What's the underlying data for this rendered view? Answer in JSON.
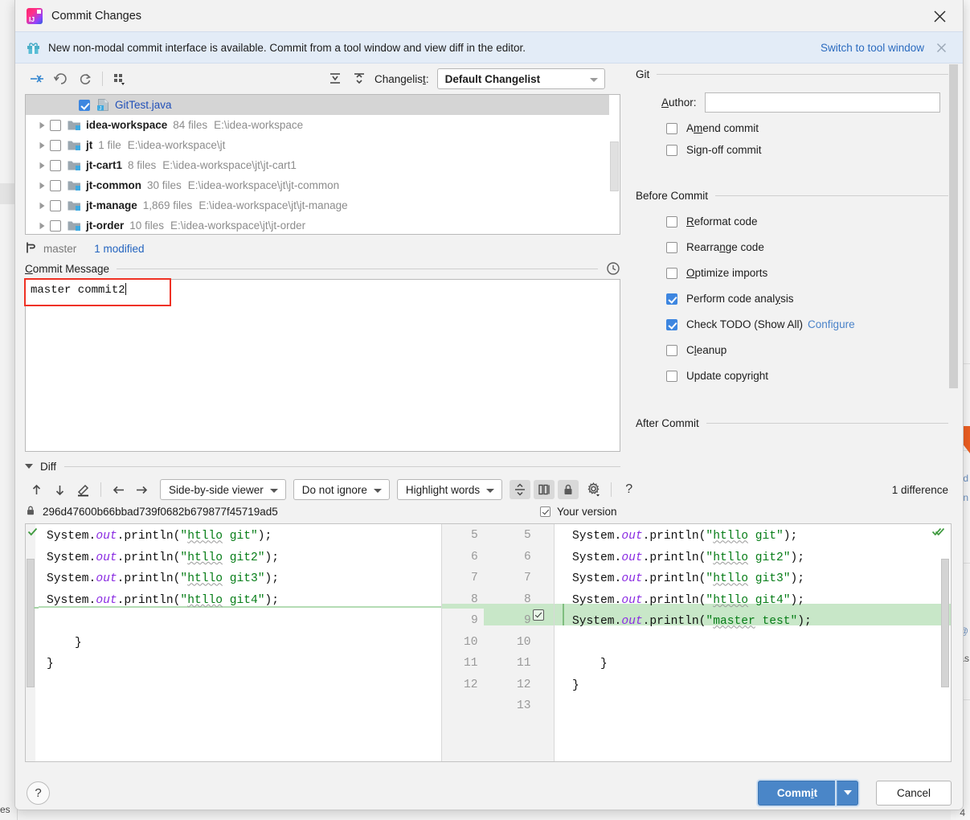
{
  "window": {
    "title": "Commit Changes",
    "logo_icon": "intellij-idea-logo",
    "close_icon": "close-icon"
  },
  "banner": {
    "icon": "gift-icon",
    "message": "New non-modal commit interface is available. Commit from a tool window and view diff in the editor.",
    "link": "Switch to tool window",
    "dismiss_icon": "close-icon"
  },
  "changelist_toolbar": {
    "icons": [
      "move-to-another-changelist-icon",
      "revert-icon",
      "refresh-icon",
      "group-by-icon"
    ],
    "expand_all_icon": "expand-all-icon",
    "collapse_all_icon": "collapse-all-icon",
    "label": "Changelist:",
    "label_mnemonic": "t",
    "selected": "Default Changelist",
    "dropdown_icon": "chevron-down-icon"
  },
  "file_tree": {
    "rows": [
      {
        "indent": 2,
        "twisty": false,
        "checked": true,
        "icon": "java-file-icon",
        "name": "GitTest.java",
        "meta": "",
        "path": "",
        "selected": true,
        "link": true
      },
      {
        "indent": 0,
        "twisty": true,
        "checked": false,
        "icon": "module-folder-icon",
        "name": "idea-workspace",
        "meta": "84 files",
        "path": "E:\\idea-workspace",
        "selected": false,
        "link": false
      },
      {
        "indent": 0,
        "twisty": true,
        "checked": false,
        "icon": "module-folder-icon",
        "name": "jt",
        "meta": "1 file",
        "path": "E:\\idea-workspace\\jt",
        "selected": false,
        "link": false
      },
      {
        "indent": 0,
        "twisty": true,
        "checked": false,
        "icon": "module-folder-icon",
        "name": "jt-cart1",
        "meta": "8 files",
        "path": "E:\\idea-workspace\\jt\\jt-cart1",
        "selected": false,
        "link": false
      },
      {
        "indent": 0,
        "twisty": true,
        "checked": false,
        "icon": "module-folder-icon",
        "name": "jt-common",
        "meta": "30 files",
        "path": "E:\\idea-workspace\\jt\\jt-common",
        "selected": false,
        "link": false
      },
      {
        "indent": 0,
        "twisty": true,
        "checked": false,
        "icon": "module-folder-icon",
        "name": "jt-manage",
        "meta": "1,869 files",
        "path": "E:\\idea-workspace\\jt\\jt-manage",
        "selected": false,
        "link": false
      },
      {
        "indent": 0,
        "twisty": true,
        "checked": false,
        "icon": "module-folder-icon",
        "name": "jt-order",
        "meta": "10 files",
        "path": "E:\\idea-workspace\\jt\\jt-order",
        "selected": false,
        "link": false
      }
    ]
  },
  "branch_status": {
    "icon": "git-branch-icon",
    "branch": "master",
    "modified": "1 modified"
  },
  "commit_message": {
    "label": "Commit Message",
    "label_mnemonic": "C",
    "history_icon": "clock-history-icon",
    "value": "master commit2"
  },
  "right_panel": {
    "git_group": "Git",
    "author_label": "Author:",
    "author_mnemonic": "A",
    "author_value": "",
    "git_options": [
      {
        "label": "Amend commit",
        "checked": false,
        "mnemonic": "m"
      },
      {
        "label": "Sign-off commit",
        "checked": false,
        "mnemonic": "g"
      }
    ],
    "before_commit_group": "Before Commit",
    "before_commit_options": [
      {
        "label": "Reformat code",
        "checked": false,
        "mnemonic": "R",
        "extra": ""
      },
      {
        "label": "Rearrange code",
        "checked": false,
        "mnemonic": "n",
        "extra": ""
      },
      {
        "label": "Optimize imports",
        "checked": false,
        "mnemonic": "O",
        "extra": ""
      },
      {
        "label": "Perform code analysis",
        "checked": true,
        "mnemonic": "y",
        "extra": ""
      },
      {
        "label": "Check TODO (Show All)",
        "checked": true,
        "mnemonic": "",
        "extra": "Configure"
      },
      {
        "label": "Cleanup",
        "checked": false,
        "mnemonic": "l",
        "extra": ""
      },
      {
        "label": "Update copyright",
        "checked": false,
        "mnemonic": "",
        "extra": ""
      }
    ],
    "after_commit_group": "After Commit"
  },
  "diff": {
    "section_label": "Diff",
    "toolbar": {
      "prev_difference_icon": "arrow-up-icon",
      "next_difference_icon": "arrow-down-icon",
      "edit_icon": "pencil-icon",
      "apply_left_icon": "arrow-left-icon",
      "apply_right_icon": "arrow-right-icon",
      "viewer_mode": "Side-by-side viewer",
      "ignore_mode": "Do not ignore",
      "highlight_mode": "Highlight words",
      "collapse_unchanged_icon": "collapse-unchanged-icon",
      "compare_side_icon": "compare-columns-icon",
      "readonly_icon": "lock-icon",
      "settings_icon": "gear-icon",
      "help_icon": "question-mark-icon",
      "difference_count": "1 difference"
    },
    "left_header": {
      "lock_icon": "lock-icon",
      "revision": "296d47600b66bbad739f0682b679877f45719ad5"
    },
    "right_header": {
      "checkbox_checked": true,
      "label": "Your version"
    },
    "left_lines": [
      {
        "num": "5",
        "text": "        System.out.println(\"htllo git\");"
      },
      {
        "num": "6",
        "text": "        System.out.println(\"htllo git2\");"
      },
      {
        "num": "7",
        "text": "        System.out.println(\"htllo git3\");"
      },
      {
        "num": "8",
        "text": "        System.out.println(\"htllo git4\");"
      },
      {
        "num": "9",
        "text": ""
      },
      {
        "num": "10",
        "text": "    }"
      },
      {
        "num": "11",
        "text": "}"
      },
      {
        "num": "12",
        "text": ""
      }
    ],
    "right_lines": [
      {
        "num": "5",
        "text": "        System.out.println(\"htllo git\");",
        "added": false
      },
      {
        "num": "6",
        "text": "        System.out.println(\"htllo git2\");",
        "added": false
      },
      {
        "num": "7",
        "text": "        System.out.println(\"htllo git3\");",
        "added": false
      },
      {
        "num": "8",
        "text": "        System.out.println(\"htllo git4\");",
        "added": false
      },
      {
        "num": "9",
        "text": "        System.out.println(\"master test\");",
        "added": true
      },
      {
        "num": "10",
        "text": "",
        "added": false
      },
      {
        "num": "11",
        "text": "    }",
        "added": false
      },
      {
        "num": "12",
        "text": "}",
        "added": false
      },
      {
        "num": "13",
        "text": "",
        "added": false
      }
    ]
  },
  "footer": {
    "help_label": "?",
    "commit_label": "Commit",
    "commit_mnemonic": "i",
    "commit_dropdown_icon": "chevron-down-icon",
    "cancel_label": "Cancel"
  },
  "colors": {
    "accent_blue": "#4a86c8",
    "link_blue": "#2b6bbf",
    "added_green": "#c8e7c8",
    "highlight_red": "#ef3124",
    "banner_bg": "#e3ecf7"
  }
}
